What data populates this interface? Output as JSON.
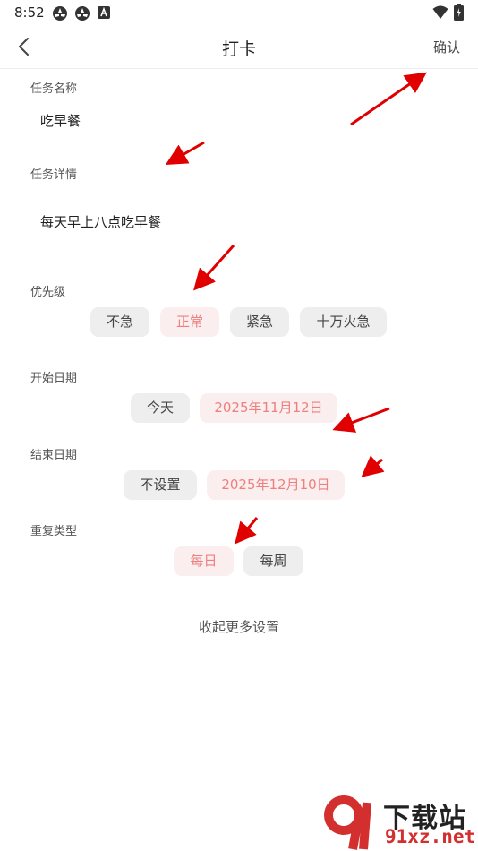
{
  "status_bar": {
    "time": "8:52"
  },
  "header": {
    "title": "打卡",
    "confirm_label": "确认"
  },
  "form": {
    "task_name": {
      "label": "任务名称",
      "value": "吃早餐"
    },
    "task_detail": {
      "label": "任务详情",
      "value": "每天早上八点吃早餐"
    },
    "priority": {
      "label": "优先级",
      "options": [
        "不急",
        "正常",
        "紧急",
        "十万火急"
      ],
      "selected": "正常"
    },
    "start_date": {
      "label": "开始日期",
      "options": [
        "今天",
        "2025年11月12日"
      ],
      "selected": "2025年11月12日"
    },
    "end_date": {
      "label": "结束日期",
      "options": [
        "不设置",
        "2025年12月10日"
      ],
      "selected": "2025年12月10日"
    },
    "repeat_type": {
      "label": "重复类型",
      "options": [
        "每日",
        "每周"
      ],
      "selected": "每日"
    }
  },
  "collapse_label": "收起更多设置",
  "watermark": {
    "line1": "下载站",
    "line2": "91xz.net",
    "logo": "91-logo"
  },
  "colors": {
    "accent": "#ee7f7f",
    "accent_bg": "#fbeeee",
    "chip_bg": "#eeeeee",
    "annotation_arrow": "#e00000"
  }
}
